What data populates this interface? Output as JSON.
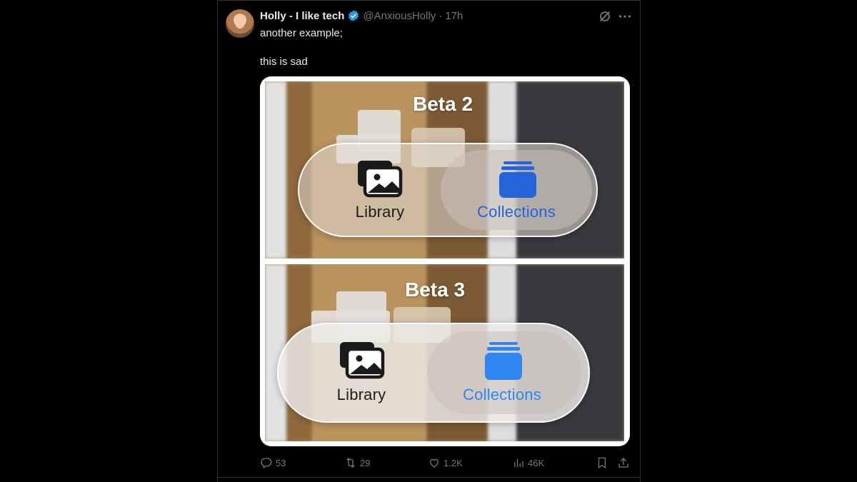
{
  "author": {
    "name": "Holly - I like tech",
    "handle": "@AnxiousHolly",
    "separator": "·",
    "time": "17h"
  },
  "tweet": {
    "line1": "another example;",
    "line2": "this is sad"
  },
  "media": {
    "panels": [
      {
        "title": "Beta 2",
        "segment_left": "Library",
        "segment_right": "Collections"
      },
      {
        "title": "Beta 3",
        "segment_left": "Library",
        "segment_right": "Collections"
      }
    ]
  },
  "actions": {
    "replies": "53",
    "reposts": "29",
    "likes": "1.2K",
    "views": "46K"
  },
  "colors": {
    "background": "#000000",
    "text": "#e7e9ea",
    "muted": "#71767b",
    "verified": "#1d9bf0",
    "accent_blue": "#2563d9"
  },
  "icons": [
    "verified-badge-icon",
    "grok-icon",
    "more-icon",
    "reply-icon",
    "repost-icon",
    "like-icon",
    "views-icon",
    "bookmark-icon",
    "share-icon",
    "library-icon",
    "collections-icon"
  ]
}
